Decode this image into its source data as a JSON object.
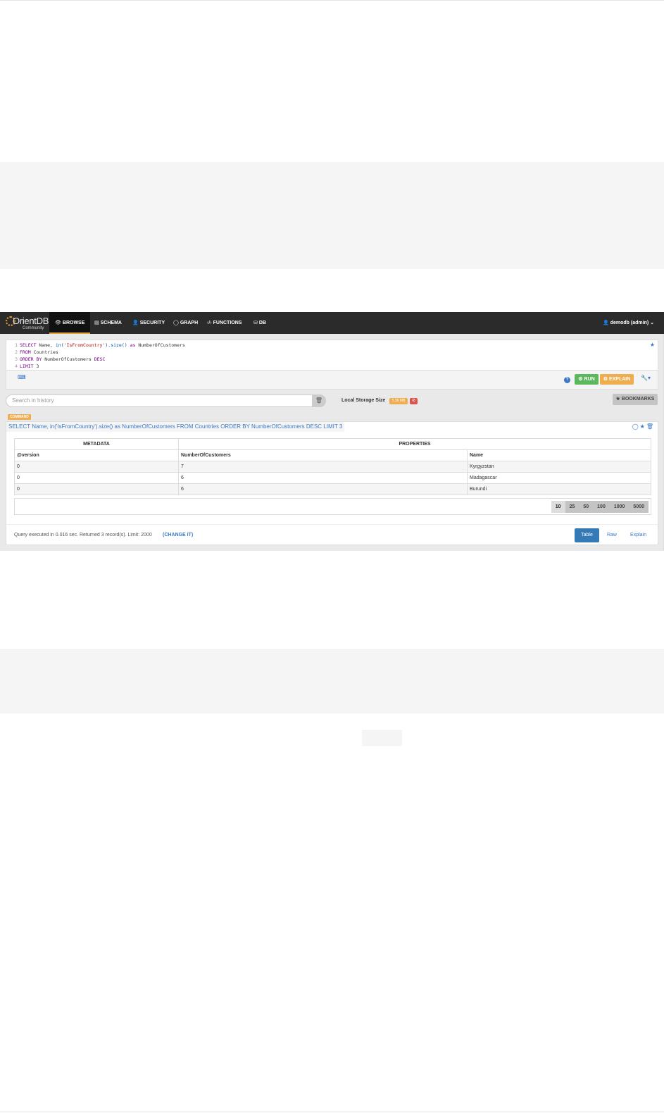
{
  "navbar": {
    "logo_text": "OrientDB",
    "logo_sub": "Community",
    "items": [
      {
        "icon": "👁",
        "label": "BROWSE"
      },
      {
        "icon": "▤",
        "label": "SCHEMA"
      },
      {
        "icon": "👤",
        "label": "SECURITY"
      },
      {
        "icon": "◯",
        "label": "GRAPH"
      },
      {
        "icon": "‹/›",
        "label": "FUNCTIONS"
      },
      {
        "icon": "⛁",
        "label": "DB"
      }
    ],
    "user": "👤 demodb (admin) ⌄"
  },
  "editor": {
    "lines": [
      {
        "n": "1",
        "t1": "SELECT",
        "t2": " Name, ",
        "t3": "in(",
        "t4": "'IsFromCountry'",
        "t5": ").size()",
        "t6": " as ",
        "t7": "NumberOfCustomers"
      },
      {
        "n": "2",
        "t1": "FROM",
        "t2": " Countries"
      },
      {
        "n": "3",
        "t1": "ORDER BY",
        "t2": " NumberOfCustomers ",
        "t3": "DESC"
      },
      {
        "n": "4",
        "t1": "LIMIT",
        "t2": " 3"
      }
    ],
    "run_label": "⚙ RUN",
    "explain_label": "⚙ EXPLAIN",
    "help": "?",
    "wrench": "🔧▾",
    "keyboard_icon": "⌨"
  },
  "history": {
    "placeholder": "Search in history",
    "clear_icon": "🗑"
  },
  "storage": {
    "label": "Local Storage Size",
    "size": "5.36 MB",
    "clear": "⊘"
  },
  "bookmarks_label": "★ BOOKMARKS",
  "result": {
    "badge": "COMMAND",
    "query": "SELECT Name, in('IsFromCountry').size() as NumberOfCustomers FROM Countries ORDER BY NumberOfCustomers DESC LIMIT 3",
    "icons": "◯★🗑",
    "groups": {
      "metadata": "METADATA",
      "properties": "PROPERTIES"
    },
    "columns": [
      "@version",
      "NumberOfCustomers",
      "Name"
    ],
    "rows": [
      [
        "0",
        "7",
        "Kyrgyzstan"
      ],
      [
        "0",
        "6",
        "Madagascar"
      ],
      [
        "0",
        "6",
        "Burundi"
      ]
    ],
    "page_sizes": [
      "10",
      "25",
      "50",
      "100",
      "1000",
      "5000"
    ],
    "status": "Query executed in 0.016 sec. Returned 3 record(s). Limit: 2000",
    "change_it": "(CHANGE IT)",
    "views": {
      "table": "Table",
      "raw": "Raw",
      "explain": "Explain"
    }
  }
}
